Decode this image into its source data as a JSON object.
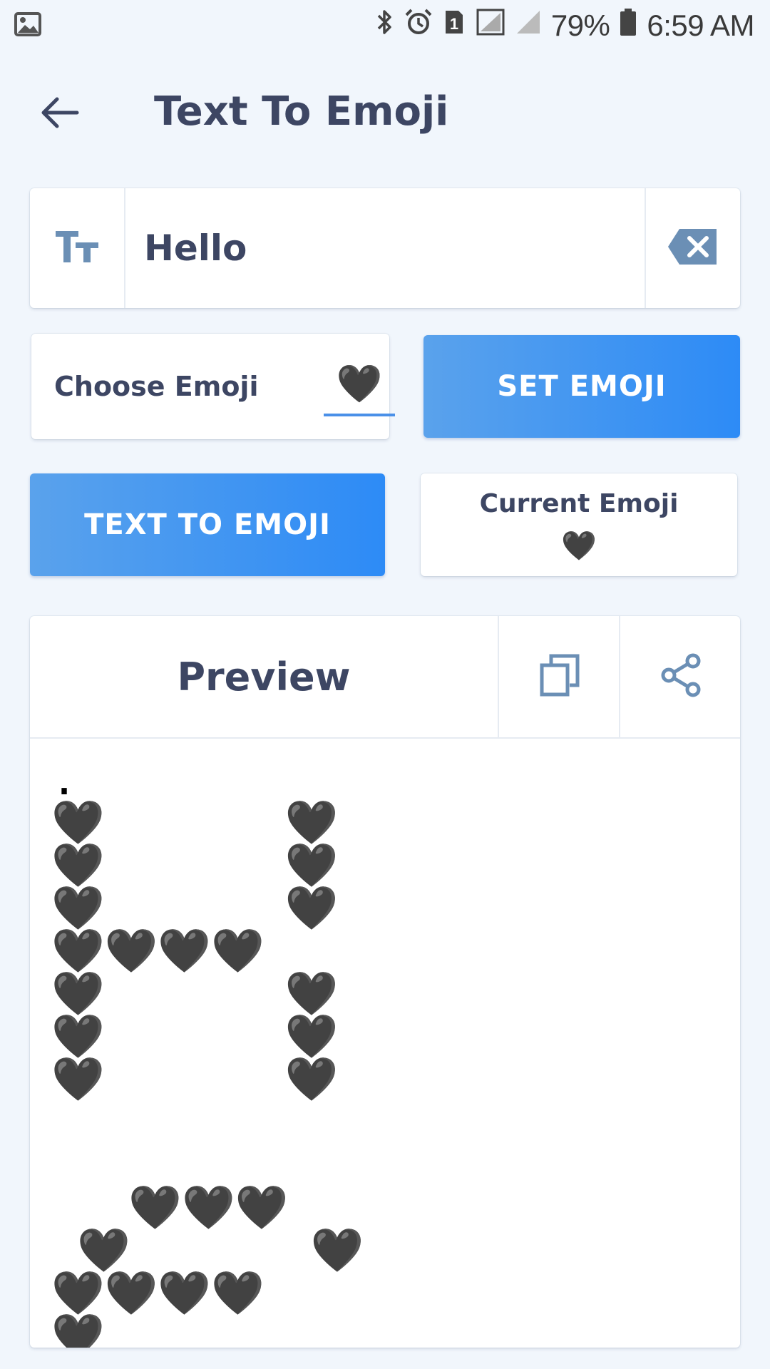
{
  "status_bar": {
    "battery_percent": "79%",
    "time": "6:59 AM",
    "sim_badge": "1",
    "icons": [
      "image-icon",
      "bluetooth-icon",
      "alarm-icon",
      "sim-icon",
      "signal-empty-icon",
      "signal-icon",
      "battery-icon"
    ]
  },
  "header": {
    "title": "Text To Emoji",
    "back_icon": "arrow-left-icon"
  },
  "text_input": {
    "icon": "text-size-icon",
    "value": "Hello",
    "clear_icon": "backspace-clear-icon"
  },
  "choose_emoji": {
    "label": "Choose Emoji",
    "selected": "🖤"
  },
  "buttons": {
    "set_emoji": "SET EMOJI",
    "text_to_emoji": "TEXT TO EMOJI"
  },
  "current_emoji": {
    "label": "Current Emoji",
    "value": "🖤"
  },
  "preview": {
    "title": "Preview",
    "copy_icon": "copy-icon",
    "share_icon": "share-icon",
    "output": ".\n🖤       🖤\n🖤       🖤\n🖤       🖤\n🖤🖤🖤🖤\n🖤       🖤\n🖤       🖤\n🖤       🖤\n\n\n   🖤🖤🖤\n 🖤       🖤\n🖤🖤🖤🖤\n🖤\n 🖤"
  },
  "colors": {
    "background": "#f1f6fc",
    "accent": "#2d8bf6",
    "text": "#3d4663",
    "icon": "#6b8fb5"
  }
}
